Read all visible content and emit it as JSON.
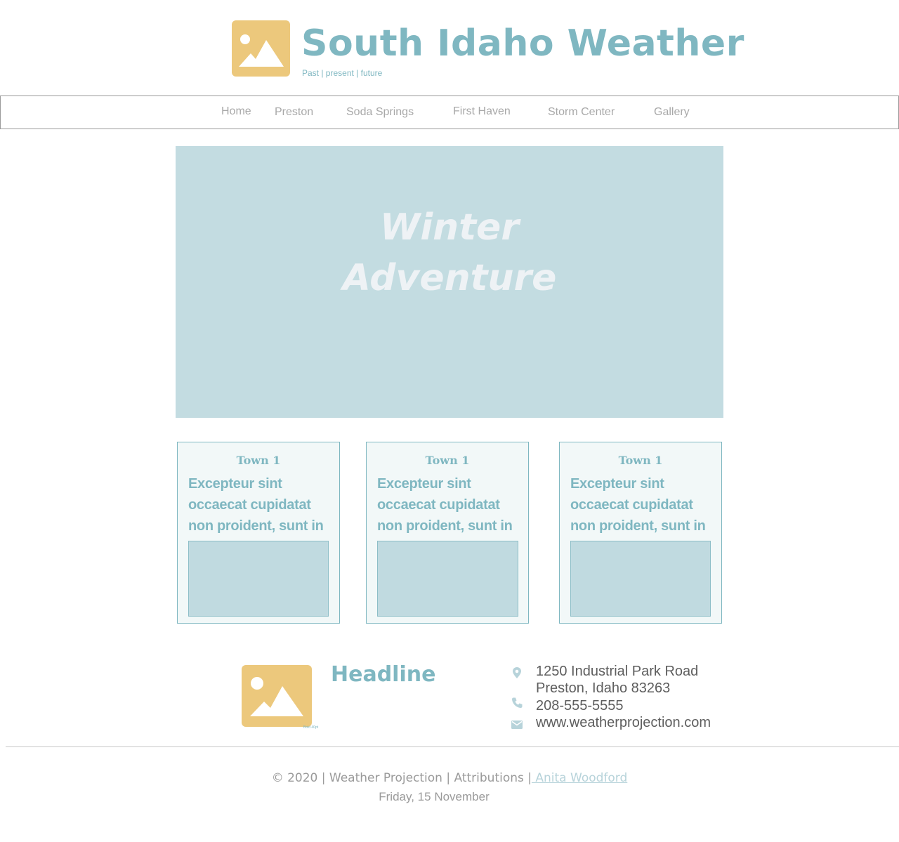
{
  "header": {
    "title": "South Idaho Weather",
    "tagline": "Past | present | future",
    "logo_icon": "image-placeholder-icon"
  },
  "nav": {
    "items": [
      "Home",
      "Preston",
      "Soda Springs",
      "First Haven",
      "Storm Center",
      "Gallery"
    ]
  },
  "hero": {
    "line1": "Winter",
    "line2": "Adventure"
  },
  "cards": [
    {
      "title": "Town 1",
      "text": "Excepteur sint occaecat cupidatat non proident, sunt in"
    },
    {
      "title": "Town 1",
      "text": "Excepteur sint occaecat cupidatat non proident, sunt in"
    },
    {
      "title": "Town 1",
      "text": "Excepteur sint occaecat cupidatat non proident, sunt in"
    }
  ],
  "footer": {
    "logo_caption": "Bold 40pt",
    "headline": "Headline",
    "address_line1": "1250 Industrial Park Road",
    "address_line2": "Preston, Idaho 83263",
    "phone": "208-555-5555",
    "website": "www.weatherprojection.com",
    "icons": [
      "location-pin-icon",
      "phone-icon",
      "envelope-icon"
    ]
  },
  "bottom": {
    "copyright": "© 2020 | Weather Projection | Attributions |",
    "author_link": " Anita Woodford",
    "date": "Friday, 15 November"
  },
  "colors": {
    "accent": "#7fb7c1",
    "logo": "#ecc87c",
    "hero_bg": "#c3dce1",
    "card_bg": "#f2f8f8",
    "nav_text": "#a8a8a8"
  }
}
